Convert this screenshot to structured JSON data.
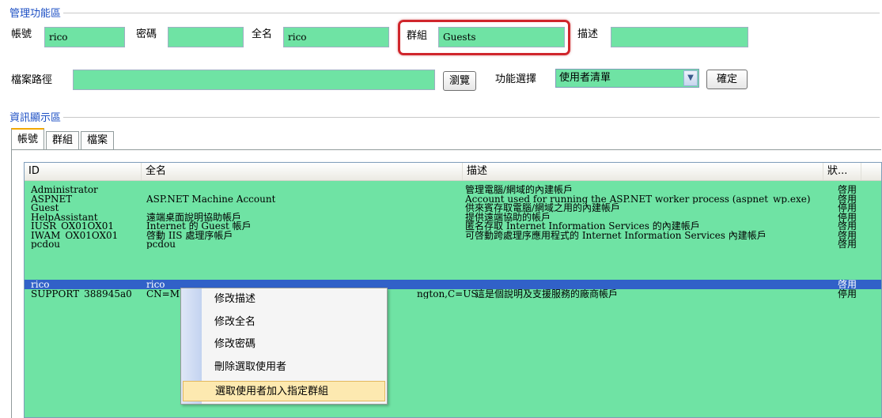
{
  "admin_group": {
    "title": "管理功能區",
    "account_label": "帳號",
    "account_value": "rico",
    "password_label": "密碼",
    "password_value": "",
    "fullname_label": "全名",
    "fullname_value": "rico",
    "group_label": "群組",
    "group_value": "Guests",
    "description_label": "描述",
    "description_value": "",
    "filepath_label": "檔案路徑",
    "filepath_value": "",
    "browse_button": "瀏覽",
    "function_label": "功能選擇",
    "function_selected": "使用者清單",
    "confirm_button": "確定"
  },
  "info_group": {
    "title": "資訊顯示區",
    "tabs": [
      {
        "label": "帳號",
        "active": true
      },
      {
        "label": "群組",
        "active": false
      },
      {
        "label": "檔案",
        "active": false
      }
    ],
    "columns": {
      "id": "ID",
      "fullname": "全名",
      "description": "描述",
      "status": "狀..."
    },
    "rows": [
      {
        "id": "Administrator",
        "fullname": "",
        "description": "管理電腦/網域的內建帳戶",
        "status": "啓用"
      },
      {
        "id": "ASPNET",
        "fullname": "ASP.NET Machine Account",
        "description": "Account used for running the ASP.NET worker process (aspnet_wp.exe)",
        "status": "啓用"
      },
      {
        "id": "Guest",
        "fullname": "",
        "description": "供來賓存取電腦/網域之用的內建帳戶",
        "status": "停用"
      },
      {
        "id": "HelpAssistant",
        "fullname": "遠端桌面說明協助帳戶",
        "description": "提供遠端協助的帳戶",
        "status": "停用"
      },
      {
        "id": "IUSR_OX01OX01",
        "fullname": "Internet 的 Guest 帳戶",
        "description": "匿名存取 Internet Information Services 的內建帳戶",
        "status": "啓用"
      },
      {
        "id": "IWAM_OX01OX01",
        "fullname": "啓動 IIS 處理序帳戶",
        "description": "可啓動跨處理序應用程式的 Internet Information Services 內建帳戶",
        "status": "啓用"
      },
      {
        "id": "pcdou",
        "fullname": "pcdou",
        "description": "",
        "status": "啓用"
      },
      {
        "id": "rico",
        "fullname": "rico",
        "description": "",
        "status": "啓用",
        "selected": true
      },
      {
        "id": "SUPPORT_388945a0",
        "fullname": "CN=M",
        "fullname_tail": "ngton,C=US",
        "description": "這是個說明及支援服務的廠商帳戶",
        "status": "停用"
      }
    ]
  },
  "context_menu": {
    "items": [
      {
        "label": "修改描述"
      },
      {
        "label": "修改全名"
      },
      {
        "label": "修改密碼"
      },
      {
        "label": "刪除選取使用者"
      },
      {
        "label": "選取使用者加入指定群組",
        "highlighted": true
      }
    ]
  },
  "colors": {
    "field_green": "#6fe3a4",
    "selection_blue": "#3161c8",
    "group_title_blue": "#1c4fc4",
    "highlight_red": "#d0262c"
  }
}
